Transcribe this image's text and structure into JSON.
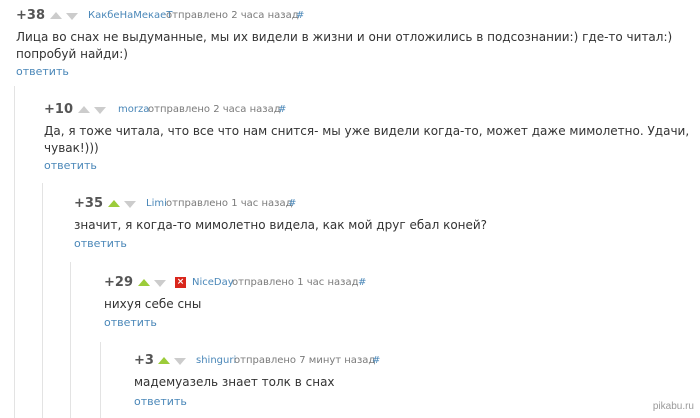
{
  "comments": [
    {
      "score": "+38",
      "author": "КакбеНаМекаеТ",
      "posted": "отправлено 2 часа назад",
      "hash": "#",
      "text": "Лица во снах не выдуманные, мы их видели в жизни и они отложились в подсознании:) где-то читал:)\nпопробуй найди:)",
      "reply": "ответить",
      "voted_up": false,
      "flag": false
    },
    {
      "score": "+10",
      "author": "morza",
      "posted": "отправлено 2 часа назад",
      "hash": "#",
      "text": "Да, я тоже читала, что все что нам снится- мы уже видели когда-то, может даже мимолетно. Удачи,\nчувак!)))",
      "reply": "ответить",
      "voted_up": false,
      "flag": false
    },
    {
      "score": "+35",
      "author": "Limi",
      "posted": "отправлено 1 час назад",
      "hash": "#",
      "text": "значит, я когда-то мимолетно видела, как мой друг ебал коней?",
      "reply": "ответить",
      "voted_up": true,
      "flag": false
    },
    {
      "score": "+29",
      "author": "NiceDay",
      "posted": "отправлено 1 час назад",
      "hash": "#",
      "text": "нихуя себе сны",
      "reply": "ответить",
      "voted_up": true,
      "flag": true
    },
    {
      "score": "+3",
      "author": "shinguri",
      "posted": "отправлено 7 минут назад",
      "hash": "#",
      "text": "мадемуазель знает толк в снах",
      "reply": "ответить",
      "voted_up": true,
      "flag": false
    }
  ],
  "icons": {
    "upvote": "upvote-arrow-icon",
    "downvote": "downvote-arrow-icon",
    "flag": "red-x-flag-icon"
  },
  "colors": {
    "link": "#4a87b8",
    "upvoted": "#9ccc3a",
    "arrow_inactive": "#cccccc",
    "flag": "#d9261c"
  },
  "watermark": "pikabu.ru"
}
